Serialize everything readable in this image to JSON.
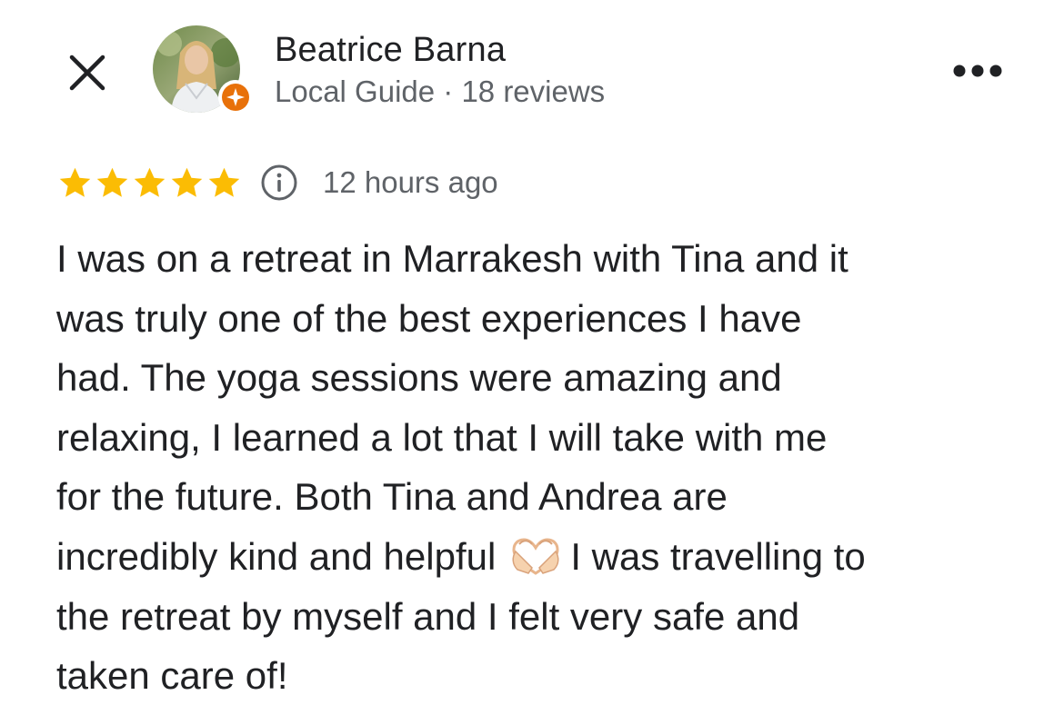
{
  "header": {
    "close_icon": "close-icon",
    "more_icon": "more-horizontal-icon",
    "author": {
      "name": "Beatrice Barna",
      "meta": "Local Guide · 18 reviews",
      "avatar": "avatar-photo",
      "badge_icon": "local-guide-star-icon",
      "badge_color": "#e8710a"
    }
  },
  "rating": {
    "stars": 5,
    "max_stars": 5,
    "star_color": "#fbbc04",
    "info_icon": "info-icon",
    "time_ago": "12 hours ago"
  },
  "review": {
    "lines": [
      "I was on a retreat in Marrakesh with Tina and it",
      "was truly one of the best experiences I have",
      "had. The yoga sessions were amazing and",
      "relaxing, I learned a lot that I will take with me",
      "for the future. Both Tina and Andrea are",
      {
        "before": "incredibly kind and helpful",
        "emoji": "heart-hands-emoji",
        "after": "I was travelling to"
      },
      "the retreat by myself and I felt very safe and",
      "taken care of!"
    ]
  }
}
